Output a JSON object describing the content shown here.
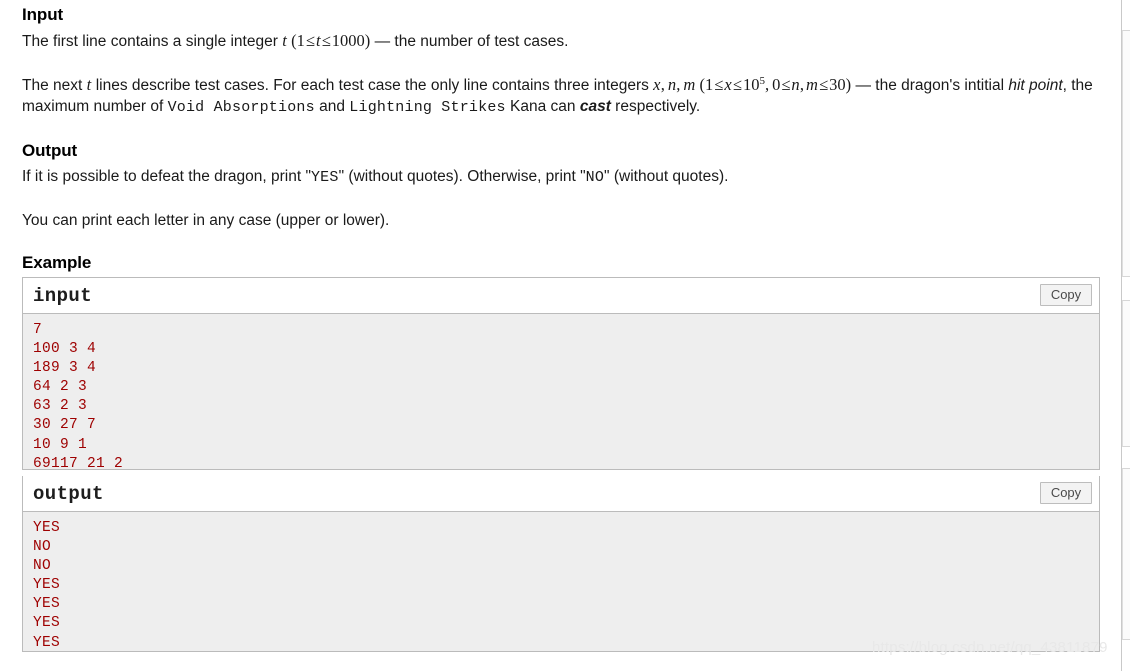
{
  "sections": {
    "input": {
      "heading": "Input",
      "p1": {
        "before": "The first line contains a single integer ",
        "var_t": "t",
        "paren_open": "(",
        "c1": "1",
        "rel1": "≤",
        "var_t2": "t",
        "rel2": "≤",
        "c2": "1000",
        "paren_close": ")",
        "after": " — the number of test cases."
      },
      "p2": {
        "s1": "The next ",
        "var_t": "t",
        "s2": " lines describe test cases. For each test case the only line contains three integers ",
        "var_x": "x",
        "comma1": ",",
        "var_n": "n",
        "comma2": ",",
        "var_m": "m",
        "paren_open": "(",
        "c1": "1",
        "rel1": "≤",
        "var_x2": "x",
        "rel2": "≤",
        "c_ten": "10",
        "c_exp": "5",
        "comma3": ",",
        "c0": "0",
        "rel3": "≤",
        "var_n2": "n",
        "comma4": ",",
        "var_m2": "m",
        "rel4": "≤",
        "c30": "30",
        "paren_close": ")",
        "dash": " — ",
        "s3": "the dragon's intitial ",
        "em_hitpoint": "hit point",
        "s4": ", the maximum number of ",
        "tt1": "Void Absorptions",
        "s5": " and ",
        "tt2": "Lightning Strikes",
        "s6": " Kana can ",
        "em_cast": "cast",
        "s7": " respectively."
      }
    },
    "output": {
      "heading": "Output",
      "p1": {
        "s1": "If it is possible to defeat the dragon, print \"",
        "tt_yes": "YES",
        "s2": "\" (without quotes). Otherwise, print \"",
        "tt_no": "NO",
        "s3": "\" (without quotes)."
      },
      "p2": "You can print each letter in any case (upper or lower)."
    },
    "example": {
      "heading": "Example"
    }
  },
  "samples": [
    {
      "title": "input",
      "copy_label": "Copy",
      "lines": [
        "7",
        "100 3 4",
        "189 3 4",
        "64 2 3",
        "63 2 3",
        "30 27 7",
        "10 9 1",
        "69117 21 2"
      ]
    },
    {
      "title": "output",
      "copy_label": "Copy",
      "lines": [
        "YES",
        "NO",
        "NO",
        "YES",
        "YES",
        "YES",
        "YES"
      ]
    }
  ],
  "watermark": {
    "text": "https://blog.csdn.net/qq_43811879"
  },
  "colors": {
    "code_text": "#9e0000",
    "code_bg": "#eeeeee",
    "border": "#bbbbbb",
    "body_text": "#1a1a1a",
    "watermark": "#e8e8e8"
  }
}
